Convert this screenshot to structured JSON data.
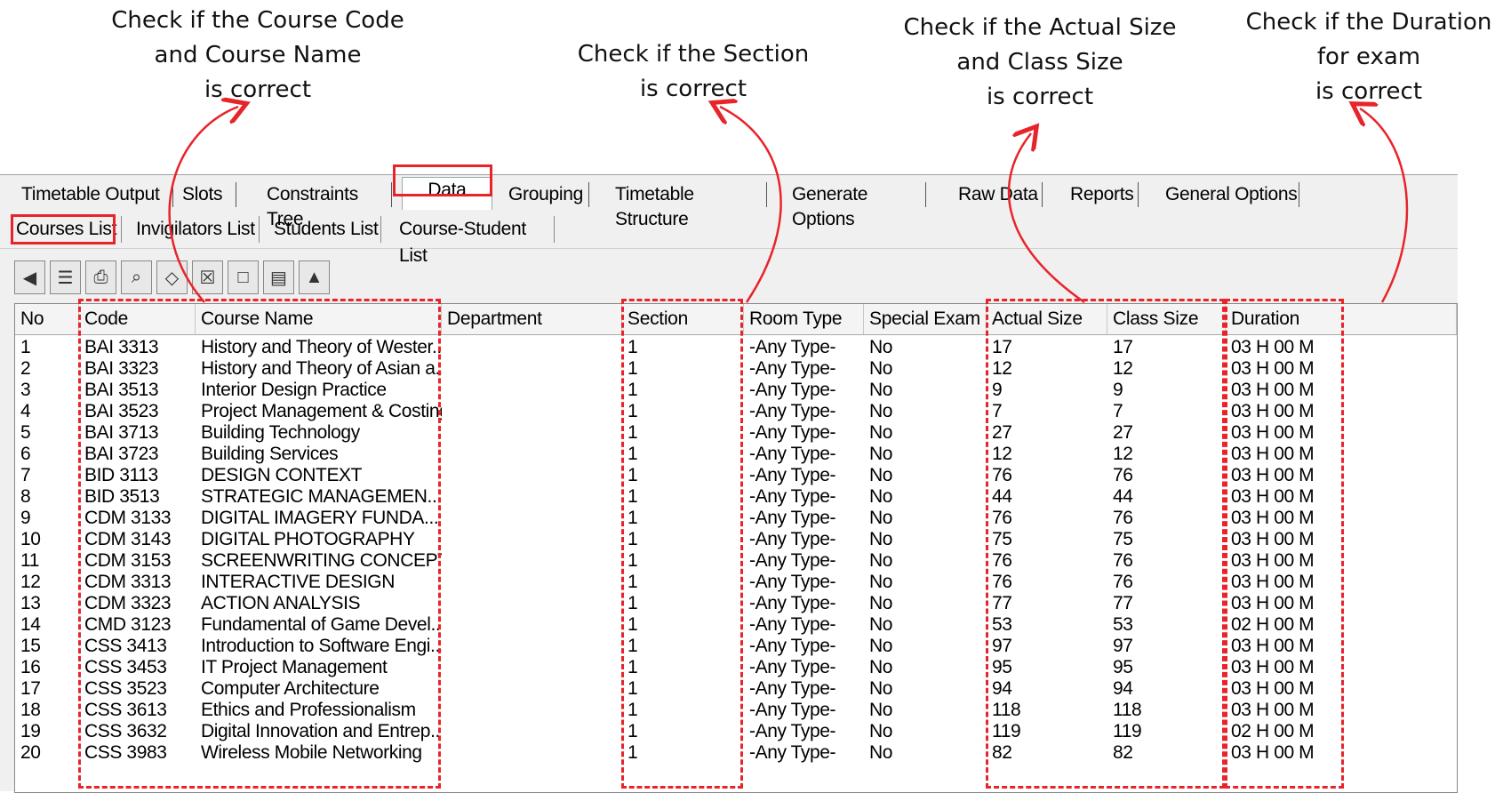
{
  "annotations": [
    {
      "text": "Check if the Course Code\nand Course Name\nis correct"
    },
    {
      "text": "Check if the Section\nis correct"
    },
    {
      "text": "Check if the Actual Size\nand Class Size\nis correct"
    },
    {
      "text": "Check if the Duration\nfor exam\nis correct"
    }
  ],
  "tabs": [
    "Timetable Output",
    "Slots",
    "Constraints Tree",
    "Data",
    "Grouping",
    "Timetable Structure",
    "Generate Options",
    "Raw Data",
    "Reports",
    "General Options"
  ],
  "active_tab": "Data",
  "subtabs": [
    "Courses List",
    "Invigilators List",
    "Students List",
    "Course-Student List"
  ],
  "active_subtab": "Courses List",
  "toolbar_icons": [
    "import-icon",
    "edit-list-icon",
    "print-icon",
    "print-preview-icon",
    "filter-icon",
    "trash-icon",
    "window-icon",
    "form-icon",
    "upload-icon"
  ],
  "columns": [
    "No",
    "Code",
    "Course Name",
    "Department",
    "Section",
    "Room Type",
    "Special Exam",
    "Actual Size",
    "Class Size",
    "Duration"
  ],
  "rows": [
    [
      "1",
      "BAI 3313",
      "History and Theory of Wester...",
      "",
      "1",
      "-Any Type-",
      "No",
      "17",
      "17",
      "03 H 00 M"
    ],
    [
      "2",
      "BAI 3323",
      "History and Theory of Asian a...",
      "",
      "1",
      "-Any Type-",
      "No",
      "12",
      "12",
      "03 H 00 M"
    ],
    [
      "3",
      "BAI 3513",
      "Interior Design Practice",
      "",
      "1",
      "-Any Type-",
      "No",
      "9",
      "9",
      "03 H 00 M"
    ],
    [
      "4",
      "BAI 3523",
      "Project Management & Costing",
      "",
      "1",
      "-Any Type-",
      "No",
      "7",
      "7",
      "03 H 00 M"
    ],
    [
      "5",
      "BAI 3713",
      "Building Technology",
      "",
      "1",
      "-Any Type-",
      "No",
      "27",
      "27",
      "03 H 00 M"
    ],
    [
      "6",
      "BAI 3723",
      "Building Services",
      "",
      "1",
      "-Any Type-",
      "No",
      "12",
      "12",
      "03 H 00 M"
    ],
    [
      "7",
      "BID 3113",
      "DESIGN CONTEXT",
      "",
      "1",
      "-Any Type-",
      "No",
      "76",
      "76",
      "03 H 00 M"
    ],
    [
      "8",
      "BID 3513",
      "STRATEGIC MANAGEMEN...",
      "",
      "1",
      "-Any Type-",
      "No",
      "44",
      "44",
      "03 H 00 M"
    ],
    [
      "9",
      "CDM 3133",
      "DIGITAL IMAGERY FUNDA...",
      "",
      "1",
      "-Any Type-",
      "No",
      "76",
      "76",
      "03 H 00 M"
    ],
    [
      "10",
      "CDM 3143",
      "DIGITAL PHOTOGRAPHY",
      "",
      "1",
      "-Any Type-",
      "No",
      "75",
      "75",
      "03 H 00 M"
    ],
    [
      "11",
      "CDM 3153",
      "SCREENWRITING CONCEPT",
      "",
      "1",
      "-Any Type-",
      "No",
      "76",
      "76",
      "03 H 00 M"
    ],
    [
      "12",
      "CDM 3313",
      "INTERACTIVE DESIGN",
      "",
      "1",
      "-Any Type-",
      "No",
      "76",
      "76",
      "03 H 00 M"
    ],
    [
      "13",
      "CDM 3323",
      "ACTION ANALYSIS",
      "",
      "1",
      "-Any Type-",
      "No",
      "77",
      "77",
      "03 H 00 M"
    ],
    [
      "14",
      "CMD 3123",
      "Fundamental of Game Devel...",
      "",
      "1",
      "-Any Type-",
      "No",
      "53",
      "53",
      "02 H 00 M"
    ],
    [
      "15",
      "CSS 3413",
      "Introduction to Software Engi...",
      "",
      "1",
      "-Any Type-",
      "No",
      "97",
      "97",
      "03 H 00 M"
    ],
    [
      "16",
      "CSS 3453",
      "IT Project Management",
      "",
      "1",
      "-Any Type-",
      "No",
      "95",
      "95",
      "03 H 00 M"
    ],
    [
      "17",
      "CSS 3523",
      "Computer Architecture",
      "",
      "1",
      "-Any Type-",
      "No",
      "94",
      "94",
      "03 H 00 M"
    ],
    [
      "18",
      "CSS 3613",
      "Ethics and Professionalism",
      "",
      "1",
      "-Any Type-",
      "No",
      "118",
      "118",
      "03 H 00 M"
    ],
    [
      "19",
      "CSS 3632",
      "Digital Innovation and Entrep...",
      "",
      "1",
      "-Any Type-",
      "No",
      "119",
      "119",
      "02 H 00 M"
    ],
    [
      "20",
      "CSS 3983",
      "Wireless Mobile Networking",
      "",
      "1",
      "-Any Type-",
      "No",
      "82",
      "82",
      "03 H 00 M"
    ]
  ],
  "colors": {
    "highlight": "#e8242b"
  }
}
